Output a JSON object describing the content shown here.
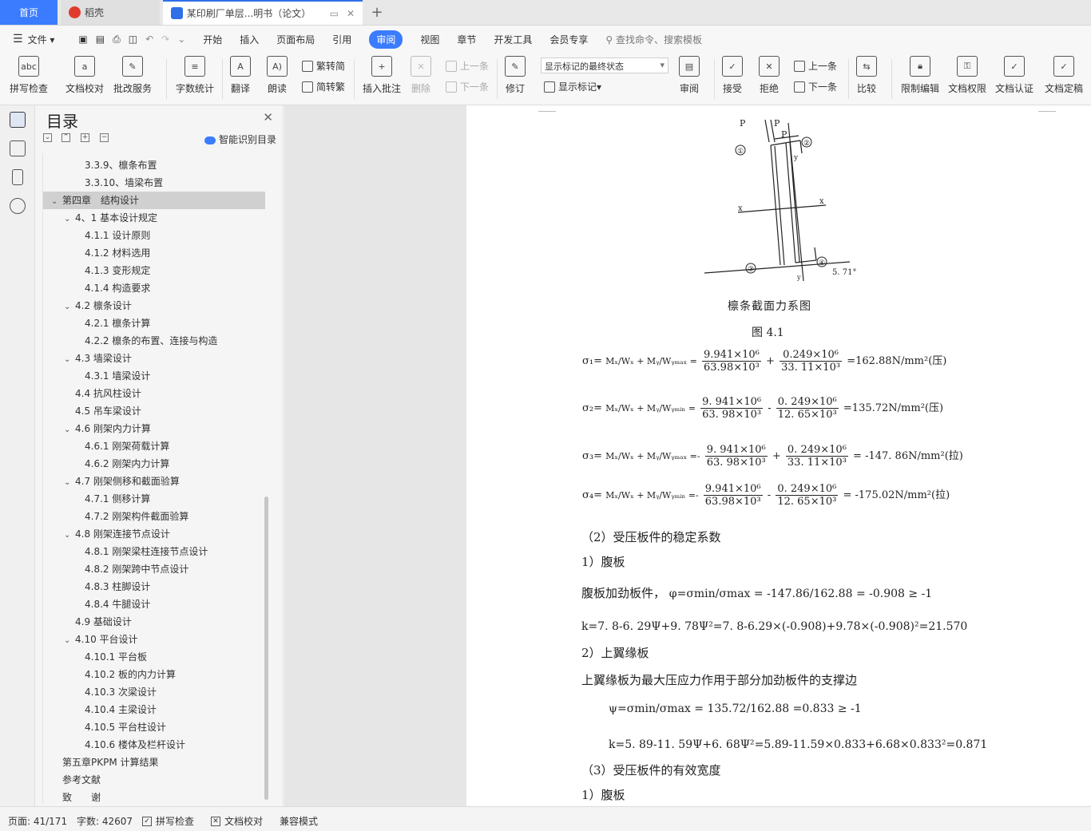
{
  "tabs": {
    "home": "首页",
    "daoke": "稻壳",
    "doc": "某印刷厂单层...明书（论文）",
    "add": "+"
  },
  "menu": {
    "file": "文件",
    "items": [
      "开始",
      "插入",
      "页面布局",
      "引用",
      "审阅",
      "视图",
      "章节",
      "开发工具",
      "会员专享"
    ],
    "active": "审阅",
    "search": "查找命令、搜索模板"
  },
  "ribbon": {
    "spell": "拼写检查",
    "proof": "文档校对",
    "review_service": "批改服务",
    "word_count": "字数统计",
    "translate": "翻译",
    "read_aloud": "朗读",
    "to_trad": "繁转简",
    "to_simp": "简转繁",
    "insert_comment": "插入批注",
    "delete": "删除",
    "prev_comment": "上一条",
    "next_comment": "下一条",
    "track": "修订",
    "markup_state": "显示标记的最终状态",
    "show_markup": "显示标记",
    "review": "审阅",
    "accept": "接受",
    "reject": "拒绝",
    "prev_change": "上一条",
    "next_change": "下一条",
    "compare": "比较",
    "restrict": "限制编辑",
    "permission": "文档权限",
    "certify": "文档认证",
    "finalize": "文档定稿"
  },
  "toc": {
    "title": "目录",
    "smart": "智能识别目录",
    "items": [
      {
        "label": "3.3.9、檩条布置",
        "level": 3
      },
      {
        "label": "3.3.10、墙梁布置",
        "level": 3
      },
      {
        "label": "第四章　结构设计",
        "level": 1,
        "expanded": true,
        "selected": true
      },
      {
        "label": "4、1 基本设计规定",
        "level": 2,
        "expanded": true
      },
      {
        "label": "4.1.1 设计原则",
        "level": 3
      },
      {
        "label": "4.1.2 材料选用",
        "level": 3
      },
      {
        "label": "4.1.3 变形规定",
        "level": 3
      },
      {
        "label": "4.1.4 构造要求",
        "level": 3
      },
      {
        "label": "4.2 檩条设计",
        "level": 2,
        "expanded": true
      },
      {
        "label": "4.2.1 檩条计算",
        "level": 3
      },
      {
        "label": "4.2.2 檩条的布置、连接与构造",
        "level": 3
      },
      {
        "label": "4.3 墙梁设计",
        "level": 2,
        "expanded": true
      },
      {
        "label": "4.3.1 墙梁设计",
        "level": 3
      },
      {
        "label": "4.4 抗风柱设计",
        "level": 2
      },
      {
        "label": "4.5 吊车梁设计",
        "level": 2
      },
      {
        "label": "4.6 刚架内力计算",
        "level": 2,
        "expanded": true
      },
      {
        "label": "4.6.1 刚架荷载计算",
        "level": 3
      },
      {
        "label": "4.6.2 刚架内力计算",
        "level": 3
      },
      {
        "label": "4.7 刚架侧移和截面验算",
        "level": 2,
        "expanded": true
      },
      {
        "label": "4.7.1 侧移计算",
        "level": 3
      },
      {
        "label": "4.7.2 刚架构件截面验算",
        "level": 3
      },
      {
        "label": "4.8 刚架连接节点设计",
        "level": 2,
        "expanded": true
      },
      {
        "label": "4.8.1 刚架梁柱连接节点设计",
        "level": 3
      },
      {
        "label": "4.8.2 刚架跨中节点设计",
        "level": 3
      },
      {
        "label": "4.8.3 柱脚设计",
        "level": 3
      },
      {
        "label": "4.8.4 牛腿设计",
        "level": 3
      },
      {
        "label": "4.9 基础设计",
        "level": 2
      },
      {
        "label": "4.10 平台设计",
        "level": 2,
        "expanded": true
      },
      {
        "label": "4.10.1 平台板",
        "level": 3
      },
      {
        "label": "4.10.2 板的内力计算",
        "level": 3
      },
      {
        "label": "4.10.3 次梁设计",
        "level": 3
      },
      {
        "label": "4.10.4 主梁设计",
        "level": 3
      },
      {
        "label": "4.10.5 平台柱设计",
        "level": 3
      },
      {
        "label": "4.10.6 楼体及栏杆设计",
        "level": 3
      },
      {
        "label": "第五章PKPM 计算结果",
        "level": 1
      },
      {
        "label": "参考文献",
        "level": 1
      },
      {
        "label": "致　　谢",
        "level": 1
      }
    ]
  },
  "document": {
    "figure_labels": {
      "p_left": "P",
      "p_right": "P",
      "px": "P",
      "n1": "①",
      "n2": "②",
      "n3": "③",
      "n4": "④",
      "x_left": "x",
      "x_right": "x",
      "y_top": "y",
      "y_bottom": "y",
      "angle": "5. 71°"
    },
    "figure_caption": "檩条截面力系图",
    "figure_number": "图 4.1",
    "formulas": {
      "s1_lhs": "σ₁=",
      "s1_m": "Mₓ/Wₓ + Mᵧ/Wᵧₘₐₓ =",
      "s1_n1": "9.941×10⁶",
      "s1_d1": "63.98×10³",
      "s1_op": "+",
      "s1_n2": "0.249×10⁶",
      "s1_d2": "33. 11×10³",
      "s1_res": "=162.88N/mm²(压)",
      "s2_lhs": "σ₂=",
      "s2_m": "Mₓ/Wₓ + Mᵧ/Wᵧₘᵢₙ =",
      "s2_n1": "9. 941×10⁶",
      "s2_d1": "63. 98×10³",
      "s2_op": "-",
      "s2_n2": "0. 249×10⁶",
      "s2_d2": "12. 65×10³",
      "s2_res": "=135.72N/mm²(压)",
      "s3_lhs": "σ₃=",
      "s3_m": "Mₓ/Wₓ + Mᵧ/Wᵧₘₐₓ =-",
      "s3_n1": "9. 941×10⁶",
      "s3_d1": "63. 98×10³",
      "s3_op": "+",
      "s3_n2": "0. 249×10⁶",
      "s3_d2": "33. 11×10³",
      "s3_res": "= -147. 86N/mm²(拉)",
      "s4_lhs": "σ₄=",
      "s4_m": "Mₓ/Wₓ + Mᵧ/Wᵧₘᵢₙ =-",
      "s4_n1": "9.941×10⁶",
      "s4_d1": "63.98×10³",
      "s4_op": "-",
      "s4_n2": "0. 249×10⁶",
      "s4_d2": "12. 65×10³",
      "s4_res": "= -175.02N/mm²(拉)"
    },
    "para_stability": "（2）受压板件的稳定系数",
    "para_web1": "1）腹板",
    "para_stiffened": "腹板加劲板件，",
    "phi_formula": "φ=σmin/σmax = -147.86/162.88 = -0.908 ≥ -1",
    "k1_formula": "k=7. 8-6. 29Ψ+9. 78Ψ²=7. 8-6.29×(-0.908)+9.78×(-0.908)²=21.570",
    "para_flange": "2）上翼缘板",
    "para_flange_desc": "上翼缘板为最大压应力作用于部分加劲板件的支撑边",
    "psi_formula": "ψ=σmin/σmax = 135.72/162.88 =0.833 ≥ -1",
    "k2_formula": "k=5. 89-11. 59Ψ+6. 68Ψ²=5.89-11.59×0.833+6.68×0.833²=0.871",
    "para_effective": "（3）受压板件的有效宽度",
    "para_web2": "1）腹板"
  },
  "status": {
    "page": "页面: 41/171",
    "words": "字数: 42607",
    "spell": "拼写检查",
    "proof": "文档校对",
    "compat": "兼容模式"
  },
  "colors": {
    "accent": "#3b7cff",
    "daoke_red": "#e03a2f",
    "doc_blue": "#2f6fe8"
  }
}
